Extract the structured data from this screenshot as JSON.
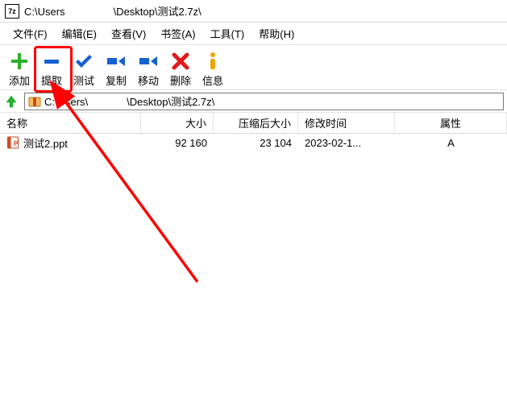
{
  "window": {
    "app_icon_label": "7z",
    "title_prefix": "C:\\Users",
    "title_suffix": "\\Desktop\\测试2.7z\\"
  },
  "menu": {
    "file": "文件(F)",
    "edit": "编辑(E)",
    "view": "查看(V)",
    "bookmarks": "书签(A)",
    "tools": "工具(T)",
    "help": "帮助(H)"
  },
  "toolbar": {
    "add": "添加",
    "extract": "提取",
    "test": "测试",
    "copy": "复制",
    "move": "移动",
    "delete": "删除",
    "info": "信息"
  },
  "address": {
    "path_prefix": "C:\\Users\\",
    "path_suffix": "\\Desktop\\测试2.7z\\"
  },
  "columns": {
    "name": "名称",
    "size": "大小",
    "packed": "压缩后大小",
    "mtime": "修改时间",
    "attr": "属性"
  },
  "rows": [
    {
      "name": "测试2.ppt",
      "size": "92 160",
      "packed": "23 104",
      "mtime": "2023-02-1...",
      "attr": "A"
    }
  ],
  "icons": {
    "add_color": "#2bb02b",
    "extract_color": "#1560d0",
    "test_color": "#1560d0",
    "copy_color": "#1560d0",
    "move_color": "#1560d0",
    "delete_color": "#e01b1b",
    "info_color": "#f0a400",
    "up_color": "#2bb02b",
    "ppt_color": "#d24726"
  }
}
